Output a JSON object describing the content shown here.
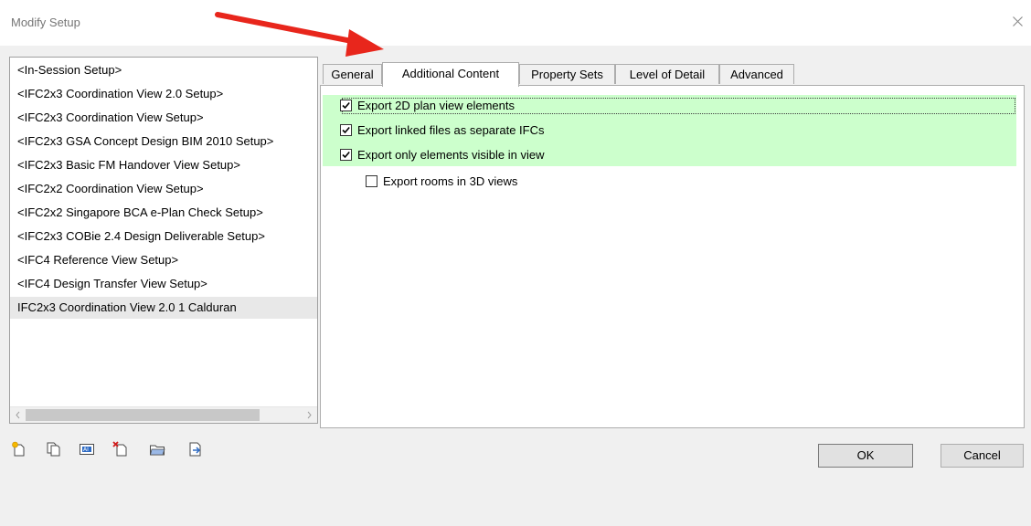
{
  "window": {
    "title": "Modify Setup"
  },
  "setups": [
    {
      "label": "<In-Session Setup>"
    },
    {
      "label": "<IFC2x3 Coordination View 2.0 Setup>"
    },
    {
      "label": "<IFC2x3 Coordination View Setup>"
    },
    {
      "label": "<IFC2x3 GSA Concept Design BIM 2010 Setup>"
    },
    {
      "label": "<IFC2x3 Basic FM Handover View Setup>"
    },
    {
      "label": "<IFC2x2 Coordination View Setup>"
    },
    {
      "label": "<IFC2x2 Singapore BCA e-Plan Check Setup>"
    },
    {
      "label": "<IFC2x3 COBie 2.4 Design Deliverable Setup>"
    },
    {
      "label": "<IFC4 Reference View Setup>"
    },
    {
      "label": "<IFC4 Design Transfer View Setup>"
    },
    {
      "label": "IFC2x3 Coordination View 2.0 1 Calduran",
      "selected": true
    }
  ],
  "tabs": [
    {
      "label": "General"
    },
    {
      "label": "Additional Content",
      "active": true
    },
    {
      "label": "Property Sets"
    },
    {
      "label": "Level of Detail"
    },
    {
      "label": "Advanced"
    }
  ],
  "options": [
    {
      "label": "Export 2D plan view elements",
      "checked": true
    },
    {
      "label": "Export linked files as separate IFCs",
      "checked": true
    },
    {
      "label": "Export only elements visible in view",
      "checked": true
    },
    {
      "label": "Export rooms in 3D views",
      "checked": false
    }
  ],
  "toolbar": {
    "icons": [
      "new-setup-icon",
      "duplicate-setup-icon",
      "rename-setup-icon",
      "delete-setup-icon",
      "import-setup-icon",
      "export-setup-icon"
    ]
  },
  "buttons": {
    "ok": "OK",
    "cancel": "Cancel"
  },
  "colors": {
    "highlight": "#ccffcc",
    "annotation_arrow": "#e8261c"
  }
}
